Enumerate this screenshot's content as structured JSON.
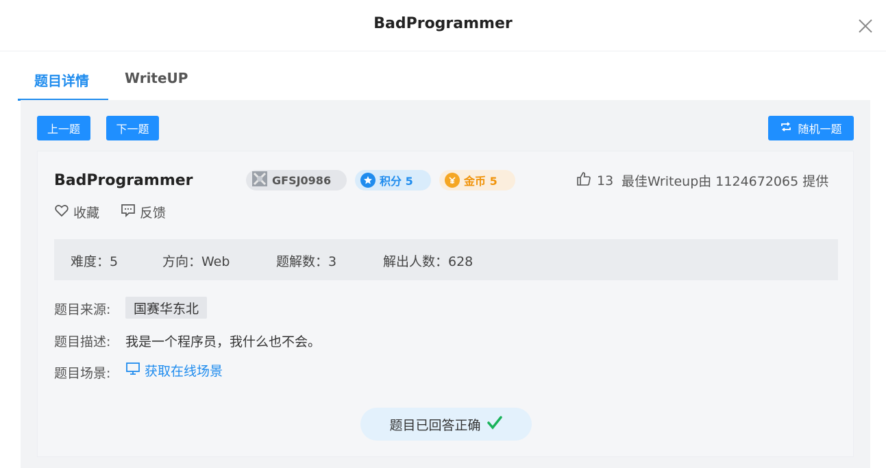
{
  "header": {
    "title": "BadProgrammer"
  },
  "tabs": [
    {
      "label": "题目详情",
      "active": true
    },
    {
      "label": "WriteUP",
      "active": false
    }
  ],
  "nav": {
    "prev_label": "上一题",
    "next_label": "下一题",
    "random_label": "随机一题"
  },
  "challenge": {
    "title": "BadProgrammer",
    "id": "GFSJ0986",
    "score_label": "积分 5",
    "coin_label": "金币 5",
    "likes": "13",
    "writeup_credit": "最佳Writeup由 1124672065 提供",
    "favorite_label": "收藏",
    "feedback_label": "反馈"
  },
  "stats": {
    "difficulty": "难度：5",
    "direction": "方向：Web",
    "writeups": "题解数：3",
    "solvers": "解出人数：628"
  },
  "info": {
    "source_label": "题目来源:",
    "source_value": "国赛华东北",
    "desc_label": "题目描述:",
    "desc_value": "我是一个程序员，我什么也不会。",
    "scene_label": "题目场景:",
    "scene_link": "获取在线场景"
  },
  "status": {
    "answered_label": "题目已回答正确"
  },
  "colors": {
    "accent": "#1f8cee",
    "button": "#1f8fff",
    "coin": "#f0930a",
    "check": "#19b35a"
  }
}
